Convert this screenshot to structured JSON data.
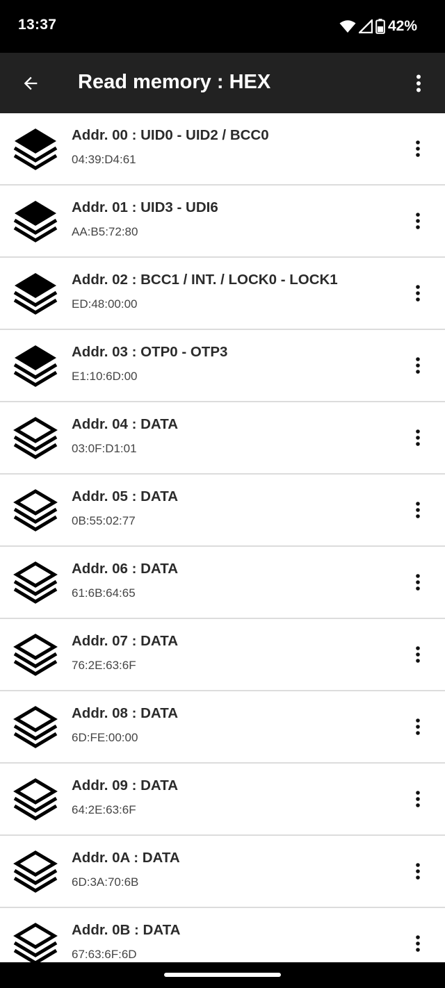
{
  "status_bar": {
    "time": "13:37",
    "battery": "42%"
  },
  "app_bar": {
    "title": "Read memory : HEX"
  },
  "rows": [
    {
      "title": "Addr. 00 : UID0 - UID2 / BCC0",
      "value": "04:39:D4:61",
      "icon": "layers-filled-icon"
    },
    {
      "title": "Addr. 01 : UID3 - UDI6",
      "value": "AA:B5:72:80",
      "icon": "layers-filled-icon"
    },
    {
      "title": "Addr. 02 : BCC1 / INT. / LOCK0 - LOCK1",
      "value": "ED:48:00:00",
      "icon": "layers-filled-icon"
    },
    {
      "title": "Addr. 03 : OTP0 - OTP3",
      "value": "E1:10:6D:00",
      "icon": "layers-filled-icon"
    },
    {
      "title": "Addr. 04 : DATA",
      "value": "03:0F:D1:01",
      "icon": "layers-outline-icon"
    },
    {
      "title": "Addr. 05 : DATA",
      "value": "0B:55:02:77",
      "icon": "layers-outline-icon"
    },
    {
      "title": "Addr. 06 : DATA",
      "value": "61:6B:64:65",
      "icon": "layers-outline-icon"
    },
    {
      "title": "Addr. 07 : DATA",
      "value": "76:2E:63:6F",
      "icon": "layers-outline-icon"
    },
    {
      "title": "Addr. 08 : DATA",
      "value": "6D:FE:00:00",
      "icon": "layers-outline-icon"
    },
    {
      "title": "Addr. 09 : DATA",
      "value": "64:2E:63:6F",
      "icon": "layers-outline-icon"
    },
    {
      "title": "Addr. 0A : DATA",
      "value": "6D:3A:70:6B",
      "icon": "layers-outline-icon"
    },
    {
      "title": "Addr. 0B : DATA",
      "value": "67:63:6F:6D",
      "icon": "layers-outline-icon"
    }
  ]
}
